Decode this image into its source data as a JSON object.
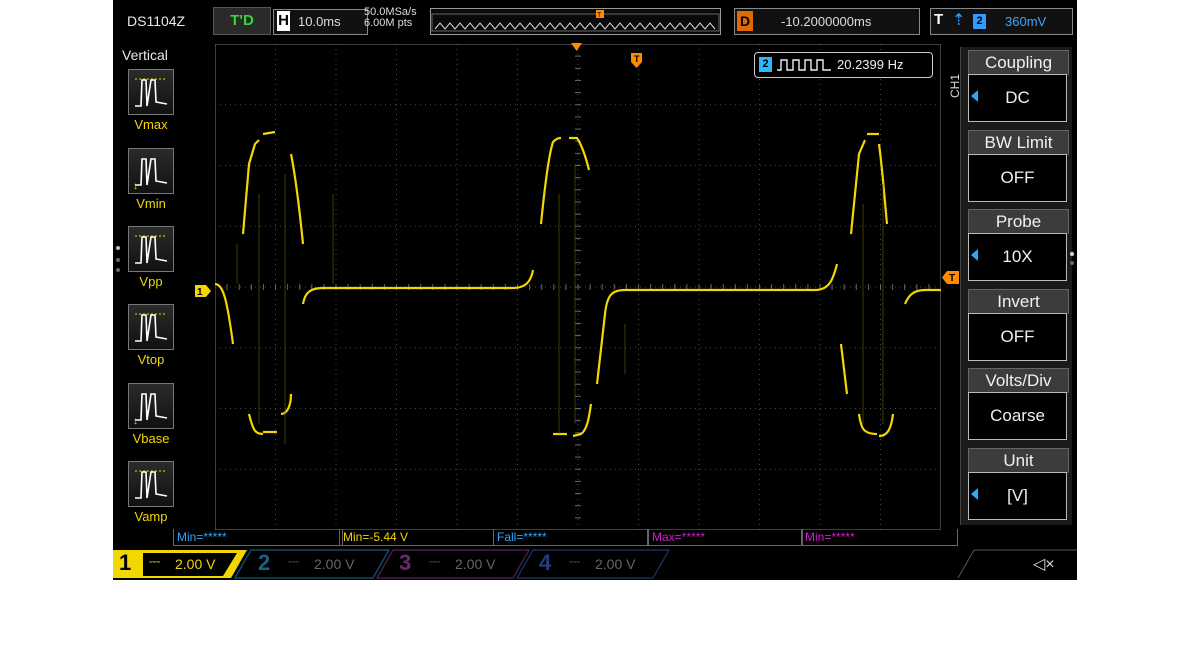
{
  "header": {
    "model": "DS1104Z",
    "trigger_status": "T'D",
    "horizontal_label": "H",
    "timebase": "10.0ms",
    "sample_rate": "50.0MSa/s",
    "memory_depth": "6.00M pts",
    "delay_label": "D",
    "delay_value": "-10.2000000ms",
    "trigger_label": "T",
    "trigger_edge_icon": "rising-edge-icon",
    "trigger_source": "2",
    "trigger_level": "360mV"
  },
  "measure_panel": {
    "title": "Vertical",
    "items": [
      {
        "label": "Vmax",
        "icon": "vmax-icon"
      },
      {
        "label": "Vmin",
        "icon": "vmin-icon"
      },
      {
        "label": "Vpp",
        "icon": "vpp-icon"
      },
      {
        "label": "Vtop",
        "icon": "vtop-icon"
      },
      {
        "label": "Vbase",
        "icon": "vbase-icon"
      },
      {
        "label": "Vamp",
        "icon": "vamp-icon"
      }
    ]
  },
  "counter": {
    "channel": "2",
    "value": "20.2399 Hz"
  },
  "menu": {
    "channel": "CH1",
    "items": [
      {
        "title": "Coupling",
        "value": "DC",
        "arrow": true
      },
      {
        "title": "BW Limit",
        "value": "OFF",
        "arrow": false
      },
      {
        "title": "Probe",
        "value": "10X",
        "arrow": true
      },
      {
        "title": "Invert",
        "value": "OFF",
        "arrow": false
      },
      {
        "title": "Volts/Div",
        "value": "Coarse",
        "arrow": false
      },
      {
        "title": "Unit",
        "value": "[V]",
        "arrow": true
      }
    ]
  },
  "results": [
    {
      "text": "Min=*****",
      "color": "#2aa8ff"
    },
    {
      "text": "Min=-5.44 V",
      "color": "#f2d700"
    },
    {
      "text": "Fall=*****",
      "color": "#2aa8ff"
    },
    {
      "text": "Max=*****",
      "color": "#d21bd2"
    },
    {
      "text": "Min=*****",
      "color": "#d21bd2"
    }
  ],
  "channels": [
    {
      "num": "1",
      "scale": "2.00 V",
      "active": true,
      "color": "#f2d700"
    },
    {
      "num": "2",
      "scale": "2.00 V",
      "active": false,
      "color": "#1b7fb0"
    },
    {
      "num": "3",
      "scale": "2.00 V",
      "active": false,
      "color": "#7a2a7a"
    },
    {
      "num": "4",
      "scale": "2.00 V",
      "active": false,
      "color": "#1f3f8a"
    }
  ],
  "markers": {
    "ch1_marker": "1",
    "trigger_marker": "T"
  },
  "colors": {
    "ch1": "#f2d700",
    "ch2": "#2aa8ff",
    "trigger": "#ff8a00"
  }
}
